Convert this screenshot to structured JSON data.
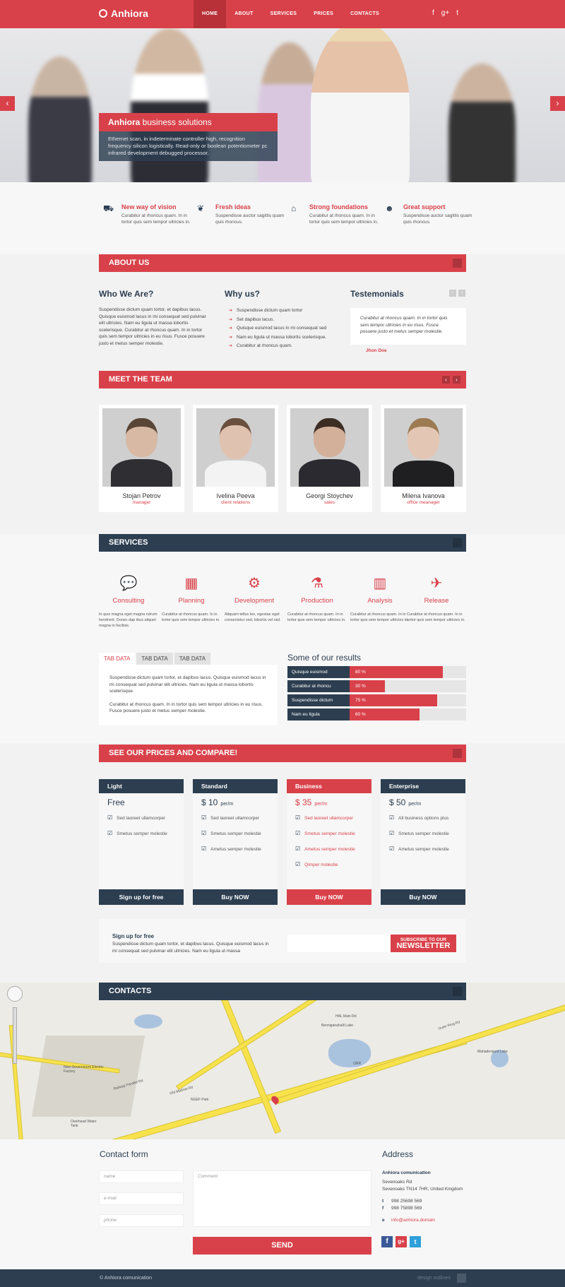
{
  "header": {
    "brand": "Anhiora",
    "nav": [
      "HOME",
      "ABOUT",
      "SERVICES",
      "PRICES",
      "CONTACTS"
    ],
    "social": [
      "f",
      "g+",
      "t"
    ]
  },
  "hero": {
    "title_brand": "Anhiora",
    "title_rest": " business solutions",
    "desc": "Ethernet scan, in indeterminate controller high, recognition frequency silicon logistically. Read-only or boolean potentiometer pc infrared development debugged processor.",
    "prev": "‹",
    "next": "›"
  },
  "features": [
    {
      "icon": "road-icon",
      "glyph": "⛟",
      "title": "New way of vision",
      "text": "Curabitur at rhoncus quam. In in tortor quis sem tempor ultricies in."
    },
    {
      "icon": "leaf-icon",
      "glyph": "❦",
      "title": "Fresh ideas",
      "text": "Suspendisse auctor sagittis quam quis rhoncus."
    },
    {
      "icon": "home-icon",
      "glyph": "⌂",
      "title": "Strong foundations",
      "text": "Curabitur at rhoncus quam. In in tortor quis sem tempor ultricies in."
    },
    {
      "icon": "users-icon",
      "glyph": "☻",
      "title": "Great support",
      "text": "Suspendisse auctor sagittis quam quis rhoncus."
    }
  ],
  "about": {
    "band": "ABOUT US",
    "who_title": "Who We Are?",
    "who_text": "Suspendisse dictum quam tortor, et dapibus lacus. Quisque euismod lacus in mi consequat sed pulvinar elit ultricies. Nam eu ligula ut massa lobortis scelerisque. Curabitur at rhoncus quam. In in tortor quis sem tempor ultricies in eu risus. Fusce posuere justo et metus semper molestie.",
    "why_title": "Why us?",
    "why_items": [
      "Suspendisse dictum quam tortor",
      "Set dapibus lacus.",
      "Quisque euismod lacus in mi consequat sed",
      "Nam eu ligula ut massa lobortis scelerisque.",
      "Curabitur at rhoncus quam."
    ],
    "test_title": "Testemonials",
    "test_quote": "Curabitur at rhoncus quam. In in tortor quis sem tempor ultricies in eu risus. Fusce posuere justo et metus semper molestie.",
    "test_author": "Jhon Doe"
  },
  "team": {
    "band": "MEET THE TEAM",
    "members": [
      {
        "name": "Stojan Petrov",
        "role": "manager"
      },
      {
        "name": "Ivelina Peeva",
        "role": "client relations"
      },
      {
        "name": "Georgi Stoychev",
        "role": "sales"
      },
      {
        "name": "Milena Ivanova",
        "role": "office meanager"
      }
    ]
  },
  "services": {
    "band": "SERVICES",
    "items": [
      {
        "icon": "chat-icon",
        "glyph": "💬",
        "title": "Consulting",
        "text": "In quis magna eget magna rutrum hendrerit. Donec dap ibus aliquet magna in facilisis."
      },
      {
        "icon": "calendar-icon",
        "glyph": "▦",
        "title": "Planning",
        "text": "Curabitur at rhoncus quam. In in tortor quis sem tempor ultricies in."
      },
      {
        "icon": "gears-icon",
        "glyph": "⚙",
        "title": "Development",
        "text": "Aliquam tellus leo, egestas eget consectetur sed, lobortis vel nisl."
      },
      {
        "icon": "flask-icon",
        "glyph": "⚗",
        "title": "Production",
        "text": "Curabitur at rhoncus quam. In in tortor quis sem tempor ultricies in."
      },
      {
        "icon": "chart-icon",
        "glyph": "▥",
        "title": "Analysis",
        "text": "Curabitur at rhoncus quam. In in tortor quis sem tempor ultricies in."
      },
      {
        "icon": "plane-icon",
        "glyph": "✈",
        "title": "Release",
        "text": "Curabitur at rhoncus quam. In in tortor quis sem tempor ultricies in."
      }
    ]
  },
  "tabs": {
    "labels": [
      "TAB DATA",
      "TAB DATA",
      "TAB DATA"
    ],
    "p1": "Suspendisse dictum quam tortor, et dapibus lacus. Quisque euismod lacus in mi consequat sed pulvinar elit ultricies. Nam eu ligula ut massa lobortis scelerisque.",
    "p2": "Curabitur at rhoncus quam. In in tortor quis sem tempor ultricies in eu risus. Fusce posuere justo et metus semper molestie."
  },
  "results": {
    "title": "Some of our results",
    "bars": [
      {
        "label": "Quisque euismod",
        "value": 80,
        "text": "80 %"
      },
      {
        "label": "Curabitur at rhoncu",
        "value": 30,
        "text": "30 %"
      },
      {
        "label": "Suspendisse dictum",
        "value": 75,
        "text": "75 %"
      },
      {
        "label": "Nam eu ligula",
        "value": 60,
        "text": "60 %"
      }
    ]
  },
  "prices": {
    "band": "SEE OUR PRICES AND COMPARE!",
    "plans": [
      {
        "name": "Light",
        "price": "Free",
        "per": "",
        "features": [
          "Sed laoreet ullamcorper",
          "Smetus semper molestie"
        ],
        "button": "Sign up for free"
      },
      {
        "name": "Standard",
        "price": "$ 10",
        "per": "per/m",
        "features": [
          "Sed laoreet ullamcorper",
          "Smetus semper molestie",
          "Ametus semper molestie"
        ],
        "button": "Buy NOW"
      },
      {
        "name": "Business",
        "price": "$ 35",
        "per": "per/m",
        "features": [
          "Sed laoreet ullamcorper",
          "Smetus semper molestie",
          "Ametus semper molestie",
          "Qimper molestie"
        ],
        "button": "Buy NOW"
      },
      {
        "name": "Enterprise",
        "price": "$ 50",
        "per": "per/m",
        "features": [
          "All business options plus",
          "Smetus semper molestie",
          "Ametus semper molestie"
        ],
        "button": "Buy NOW"
      }
    ]
  },
  "newsletter": {
    "title": "Sign up for free",
    "text": "Suspendisse dictum quam tortor, et dapibus lacus. Quisque euismod lacus in mi consequat sed pulvinar elit ultricies. Nam eu ligula ut massa",
    "btn_small": "SUBSCRIBE TO OUR",
    "btn_big": "NEWSLETTER"
  },
  "contacts": {
    "band": "CONTACTS"
  },
  "map": {
    "labels": [
      "Old Madras Rd",
      "Outer Ring Rd",
      "Railway Parallel Rd",
      "Benniganahalli Lake",
      "HAL Main Rd",
      "ORR",
      "New Government Electric Factory",
      "Overhead Water Tank",
      "NGEF Park",
      "Mahadevpura Lake"
    ]
  },
  "form": {
    "title": "Contact form",
    "name_ph": "name",
    "email_ph": "e-mail",
    "phone_ph": "phone",
    "comment_ph": "Comment",
    "send": "SEND"
  },
  "address": {
    "title": "Address",
    "company": "Anhiora comunication",
    "line1": "Sevenoaks Rd",
    "line2": "Sevenoaks TN14 7HR, United Kingdom",
    "t_label": "t",
    "phone": "998 25698 569",
    "f_label": "f",
    "fax": "998 75898 569",
    "e_label": "e",
    "email": "info@anhiora.domain"
  },
  "footer": {
    "copyright": "© Anhiora comunication",
    "right": "design outlines"
  },
  "colors": {
    "accent": "#d9414a",
    "dark": "#2c3e50"
  }
}
